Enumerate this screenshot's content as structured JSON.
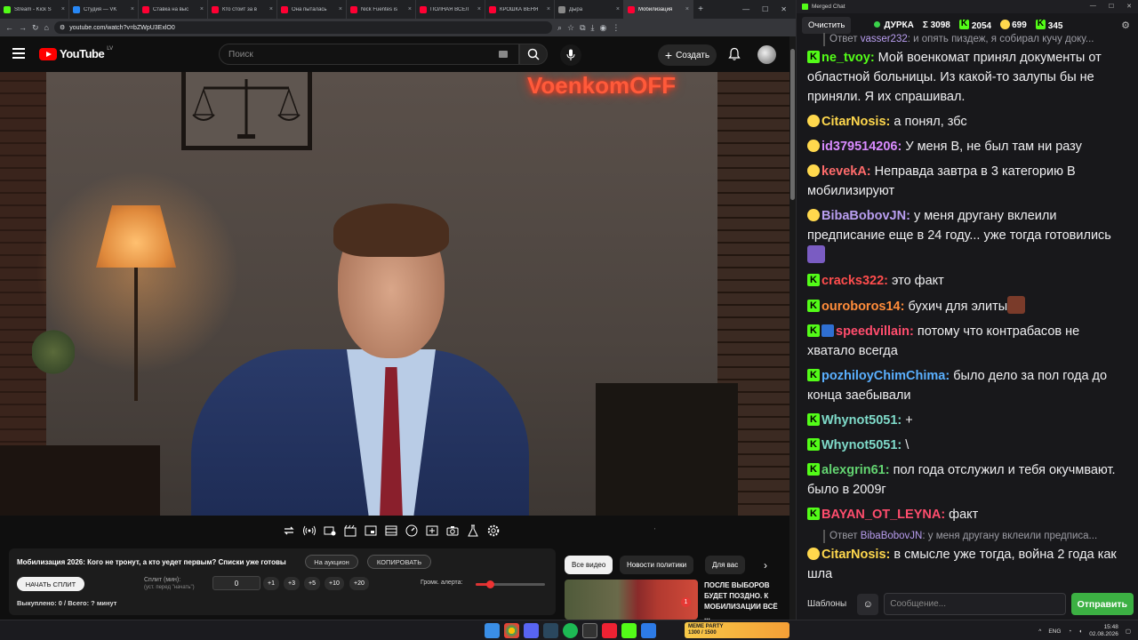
{
  "browser": {
    "tabs": [
      {
        "label": "Stream - Kick S",
        "color": "#53fc18"
      },
      {
        "label": "Студия — VK",
        "color": "#2787f5"
      },
      {
        "label": "Ставка на выс",
        "color": "#ff0033"
      },
      {
        "label": "Кто стоит за в",
        "color": "#ff0033"
      },
      {
        "label": "Она пыталась",
        "color": "#ff0033"
      },
      {
        "label": "Nick Fuentes is",
        "color": "#ff0033"
      },
      {
        "label": "ПОЛНАЯ ВСЕЛ",
        "color": "#ff0033"
      },
      {
        "label": "КРОШКА ВЕНЯ",
        "color": "#ff0033"
      },
      {
        "label": "Дыра",
        "color": "#888888"
      },
      {
        "label": "Мобилизация",
        "color": "#ff0033"
      }
    ],
    "new_tab": "+",
    "url": "youtube.com/watch?v=bZWpU3ExlO0"
  },
  "youtube": {
    "logo_text": "YouTube",
    "logo_country": "LV",
    "search_placeholder": "Поиск",
    "create_label": "Создать",
    "neon_sign": "VoenkomOFF"
  },
  "panel": {
    "title": "Мобилизация 2026: Кого не тронут, а кто уедет первым? Списки уже готовы",
    "auction_button": "На аукцион",
    "copy_button": "КОПИРОВАТЬ",
    "start_split_button": "НАЧАТЬ СПЛИТ",
    "split_label": "Сплит (мин):",
    "split_hint": "(уст. перед \"начать\")",
    "split_value": "0",
    "increments": [
      "+1",
      "+3",
      "+5",
      "+10",
      "+20"
    ],
    "alert_volume_label": "Громк. алерта:",
    "alert_volume": 0.2,
    "bought_text": "Выкуплено: 0 / Всего: ? минут"
  },
  "chips": [
    "Все видео",
    "Новости политики",
    "Для вас"
  ],
  "recommendation": {
    "title": "ПОСЛЕ ВЫБОРОВ БУДЕТ ПОЗДНО. К мобилизации всё ...",
    "badge": "1"
  },
  "chat": {
    "window_title": "Merged Chat",
    "clear_button": "Очистить",
    "channel": "ДУРКА",
    "sum_label": "Σ 3098",
    "kick_count": "2054",
    "twitch_count": "699",
    "other_count": "345",
    "messages": [
      {
        "reply": {
          "prefix": "Ответ",
          "to": "vasser232",
          "text": ": и опять пиздеж, я собирал кучу доку..."
        }
      },
      {
        "badge": "k",
        "nick": "ne_tvoy",
        "color": "#53fc18",
        "text": "Мой военкомат принял документы от областной больницы. Из какой-то залупы бы не приняли. Я их спрашивал."
      },
      {
        "badge": "tw",
        "nick": "CitarNosis",
        "color": "#ffd84d",
        "text": "а понял, збс"
      },
      {
        "badge": "tw",
        "nick": "id379514206",
        "color": "#d98bff",
        "text": "У меня В, не был там ни разу"
      },
      {
        "badge": "tw",
        "nick": "kevekA",
        "color": "#ff6b6b",
        "text": "Неправда завтра в 3 категорию В мобилизируют"
      },
      {
        "badge": "tw",
        "nick": "BibaBobovJN",
        "color": "#b99ef0",
        "text": "у меня другану вклеили предписание еще в 24 году... уже тогда готовились",
        "emote": "#7a5cc2"
      },
      {
        "badge": "k",
        "nick": "cracks322",
        "color": "#ff4d4d",
        "text": "это факт"
      },
      {
        "badge": "k",
        "nick": "ouroboros14",
        "color": "#ff8c3a",
        "text": "бухич для элиты",
        "emote": "#7a3b2a"
      },
      {
        "badge": "k",
        "badge2": "mod",
        "nick": "speedvillain",
        "color": "#ff4d6d",
        "text": "потому что контрабасов не хватало всегда"
      },
      {
        "badge": "k",
        "nick": "pozhiloyChimChima",
        "color": "#5ab0ff",
        "text": "было дело за пол года до конца заебывали"
      },
      {
        "badge": "k",
        "nick": "Whynot5051",
        "color": "#7fdbca",
        "text": "+"
      },
      {
        "badge": "k",
        "nick": "Whynot5051",
        "color": "#7fdbca",
        "text": "\\"
      },
      {
        "badge": "k",
        "nick": "alexgrin61",
        "color": "#63d471",
        "text": "пол года отслужил и тебя окучмвают. было в 2009г"
      },
      {
        "badge": "k",
        "nick": "BAYAN_OT_LEYNA",
        "color": "#ff4d6d",
        "text": "факт"
      },
      {
        "reply": {
          "prefix": "Ответ",
          "to": "BibaBobovJN",
          "text": ": у меня другану вклеили предписа..."
        }
      },
      {
        "badge": "tw",
        "nick": "CitarNosis",
        "color": "#ffd84d",
        "text": "в смысле уже тогда, война 2 года как шла"
      }
    ],
    "templates_button": "Шаблоны",
    "message_placeholder": "Сообщение...",
    "send_button": "Отправить"
  },
  "taskbar": {
    "widget_title": "MEME PARTY",
    "widget_progress": "1300 / 1500",
    "language": "ENG",
    "time": "15:48",
    "date": "02.08.2026"
  }
}
